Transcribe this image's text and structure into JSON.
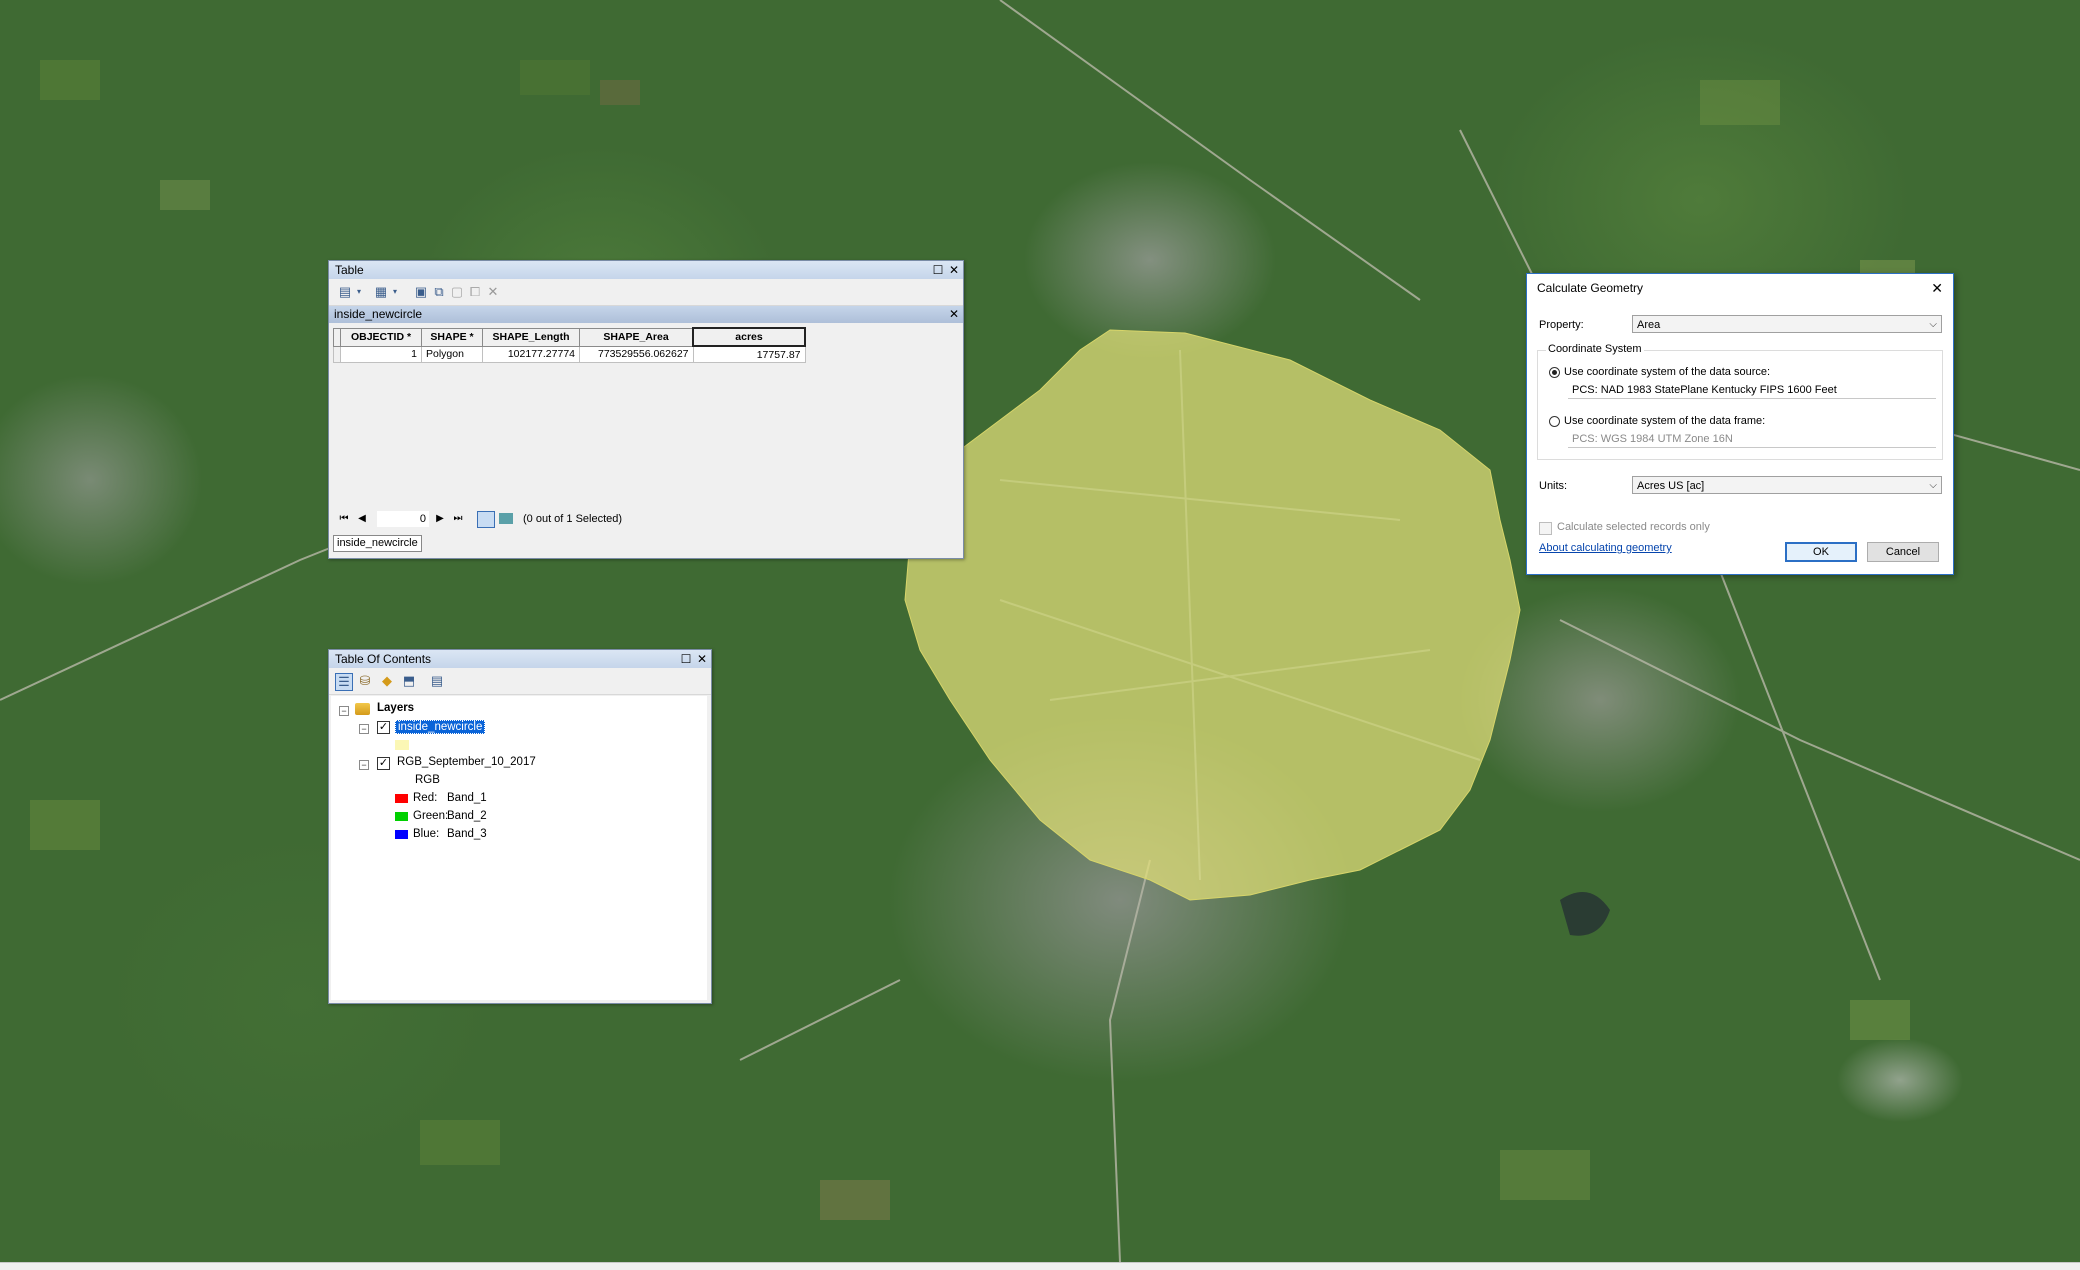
{
  "table_window": {
    "title": "Table",
    "layer_name": "inside_newcircle",
    "columns": [
      "OBJECTID *",
      "SHAPE *",
      "SHAPE_Length",
      "SHAPE_Area",
      "acres"
    ],
    "rows": [
      [
        "1",
        "Polygon",
        "102177.27774",
        "773529556.062627",
        "17757.87"
      ]
    ],
    "record_position": "0",
    "selection_status": "(0 out of 1 Selected)",
    "tab_label": "inside_newcircle"
  },
  "toc_window": {
    "title": "Table Of Contents",
    "root_label": "Layers",
    "layer1": "inside_newcircle",
    "layer2": "RGB_September_10_2017",
    "rgb_label": "RGB",
    "bands": [
      {
        "channel": "Red:",
        "band": "Band_1",
        "color": "#ff0000"
      },
      {
        "channel": "Green:",
        "band": "Band_2",
        "color": "#00d000"
      },
      {
        "channel": "Blue:",
        "band": "Band_3",
        "color": "#0000ff"
      }
    ]
  },
  "calc_dialog": {
    "title": "Calculate Geometry",
    "property_label": "Property:",
    "property_value": "Area",
    "group_label": "Coordinate System",
    "option_source": "Use coordinate system of the data source:",
    "source_cs": "PCS: NAD 1983 StatePlane Kentucky FIPS 1600 Feet",
    "option_frame": "Use coordinate system of the data frame:",
    "frame_cs": "PCS: WGS 1984 UTM Zone 16N",
    "units_label": "Units:",
    "units_value": "Acres US [ac]",
    "selected_only": "Calculate selected records only",
    "help_link": "About calculating geometry",
    "ok": "OK",
    "cancel": "Cancel"
  },
  "colors": {
    "polygon_fill": "#e3e07a",
    "selection_blue": "#0a64d8",
    "title_gradient": "#c5d5ea"
  }
}
